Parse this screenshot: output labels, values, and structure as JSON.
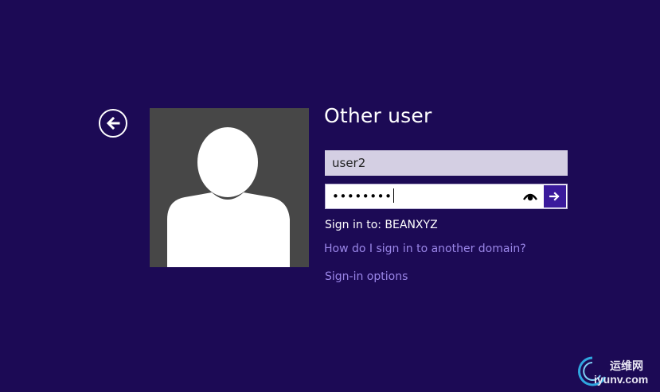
{
  "header": {
    "title": "Other user"
  },
  "form": {
    "username_value": "user2",
    "password_mask": "••••••••",
    "sign_in_to": "Sign in to: BEANXYZ"
  },
  "links": {
    "other_domain": "How do I sign in to another domain?",
    "sign_in_options": "Sign-in options"
  },
  "icons": {
    "back": "back-arrow-icon",
    "avatar": "user-avatar-icon",
    "reveal": "eye-icon",
    "submit": "arrow-right-icon"
  },
  "watermark": {
    "cn": "运维网",
    "en": "iyunv.com"
  },
  "colors": {
    "background": "#1c0a55",
    "accent": "#3a1a9c",
    "link": "#9a86e8",
    "avatar_bg": "#474747",
    "username_field": "#d4cfe3"
  }
}
